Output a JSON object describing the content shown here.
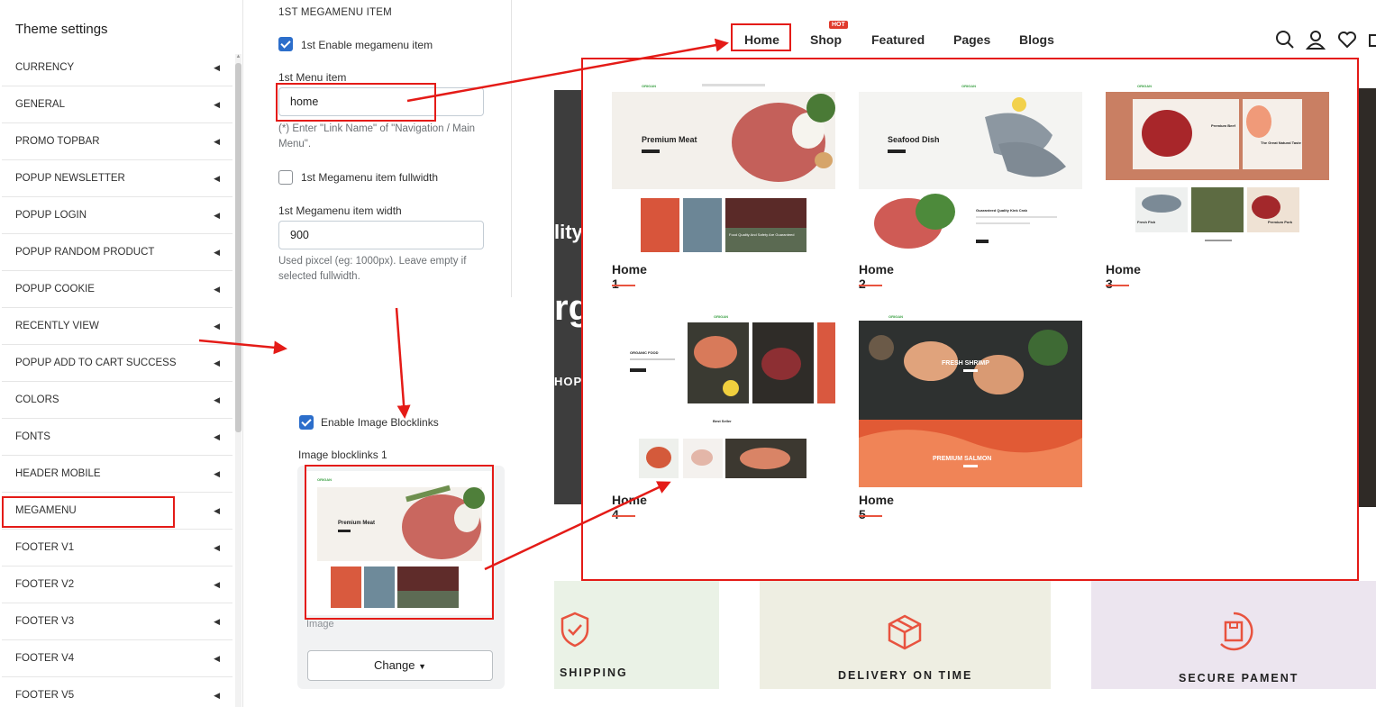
{
  "sidebar": {
    "title": "Theme settings",
    "items": [
      {
        "label": "CURRENCY"
      },
      {
        "label": "GENERAL"
      },
      {
        "label": "PROMO TOPBAR"
      },
      {
        "label": "POPUP NEWSLETTER"
      },
      {
        "label": "POPUP LOGIN"
      },
      {
        "label": "POPUP RANDOM PRODUCT"
      },
      {
        "label": "POPUP COOKIE"
      },
      {
        "label": "RECENTLY VIEW"
      },
      {
        "label": "POPUP ADD TO CART SUCCESS"
      },
      {
        "label": "COLORS"
      },
      {
        "label": "FONTS"
      },
      {
        "label": "HEADER MOBILE"
      },
      {
        "label": "MEGAMENU"
      },
      {
        "label": "FOOTER V1"
      },
      {
        "label": "FOOTER V2"
      },
      {
        "label": "FOOTER V3"
      },
      {
        "label": "FOOTER V4"
      },
      {
        "label": "FOOTER V5"
      }
    ],
    "caret_glyph": "◀"
  },
  "panel": {
    "heading": "1ST MEGAMENU ITEM",
    "enable_label": "1st Enable megamenu item",
    "enable_checked": true,
    "menu_item_label": "1st Menu item",
    "menu_item_value": "home",
    "menu_item_help": "(*) Enter \"Link Name\" of \"Navigation / Main Menu\".",
    "fullwidth_label": "1st Megamenu item fullwidth",
    "fullwidth_checked": false,
    "width_label": "1st Megamenu item width",
    "width_value": "900",
    "width_help": "Used pixcel (eg: 1000px). Leave empty if selected fullwidth."
  },
  "blocklinks": {
    "enable_label": "Enable Image Blocklinks",
    "enable_checked": true,
    "image_label": "Image blocklinks 1",
    "card_text": "Image",
    "change_label": "Change",
    "change_caret": "▼"
  },
  "store": {
    "nav": [
      {
        "label": "Home"
      },
      {
        "label": "Shop",
        "badge": "HOT"
      },
      {
        "label": "Featured"
      },
      {
        "label": "Pages"
      },
      {
        "label": "Blogs"
      }
    ],
    "header_icons": [
      "search-icon",
      "user-icon",
      "heart-icon",
      "cart-icon"
    ],
    "bg_text": {
      "line1": "lity",
      "line2": "rg",
      "line3": "HOP"
    },
    "mega_items": [
      {
        "label": "Home 1",
        "hero_title": "Premium Meat",
        "brand": "ORIGAN",
        "caption": "Food Quality And Safety Are Guaranteed"
      },
      {
        "label": "Home 2",
        "hero_title": "Seafood Dish",
        "brand": "ORIGAN",
        "caption": "Guaranteed Quality Kink Crab"
      },
      {
        "label": "Home 3",
        "hero_title": "Premium Beef",
        "hero_title2": "The Great Natural Taste",
        "brand": "ORIGAN",
        "caption": "Fresh Fish",
        "caption2": "Premium Pork"
      },
      {
        "label": "Home 4",
        "hero_title": "ORGANIC FOOD",
        "brand": "ORIGAN",
        "caption": "Best Seller"
      },
      {
        "label": "Home 5",
        "hero_title": "FRESH SHRIMP",
        "hero_title2": "PREMIUM SALMON",
        "brand": "ORIGAN"
      }
    ],
    "features": [
      {
        "label": "SHIPPING",
        "icon": "shield-check-icon",
        "bg": "#eaf2e6"
      },
      {
        "label": "DELIVERY ON TIME",
        "icon": "box-icon",
        "bg": "#eeeee2"
      },
      {
        "label": "SECURE PAMENT",
        "icon": "secure-package-icon",
        "bg": "#ece5ef"
      }
    ]
  },
  "colors": {
    "highlight": "#e41b17",
    "checkbox": "#2c6ecb",
    "accent": "#e8533f",
    "brand_green": "#3aa043"
  }
}
